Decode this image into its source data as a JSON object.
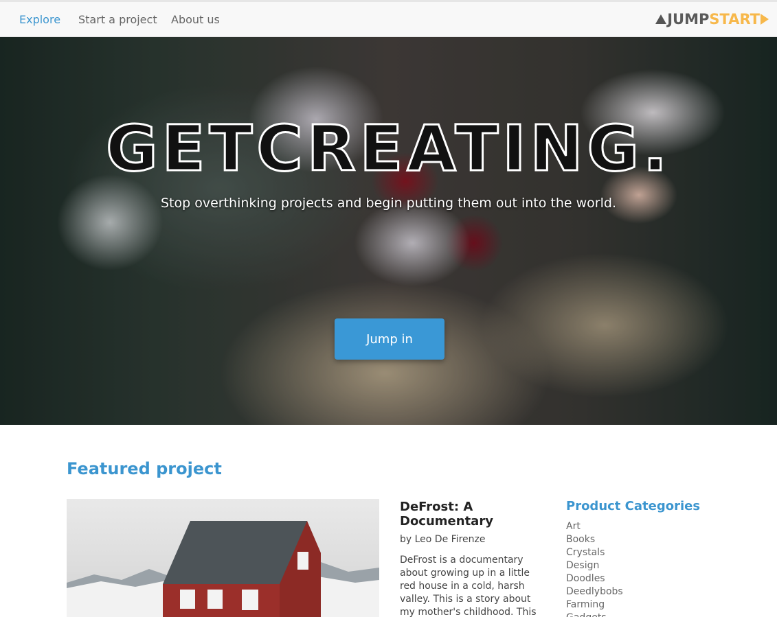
{
  "nav": {
    "items": [
      {
        "label": "Explore",
        "active": true
      },
      {
        "label": "Start a project",
        "active": false
      },
      {
        "label": "About us",
        "active": false
      }
    ],
    "logo": {
      "part1": "JUMP",
      "part2": "START"
    }
  },
  "hero": {
    "title": "GETCREATING.",
    "subtitle": "Stop overthinking projects and begin putting them out into the world.",
    "button_label": "Jump in"
  },
  "featured": {
    "section_title": "Featured project",
    "project_title": "DeFrost: A Documentary",
    "author": "by Leo De Firenze",
    "description": "DeFrost is a documentary about growing up in a little red house in a cold, harsh valley. This is a story about my mother's childhood. This film attempts to"
  },
  "categories": {
    "title": "Product Categories",
    "items": [
      "Art",
      "Books",
      "Crystals",
      "Design",
      "Doodles",
      "Deedlybobs",
      "Farming",
      "Gadgets"
    ]
  },
  "colors": {
    "accent": "#3b95cf",
    "logo_dark": "#5a5a5a",
    "logo_orange": "#f7b84b",
    "button": "#3a98d6"
  }
}
